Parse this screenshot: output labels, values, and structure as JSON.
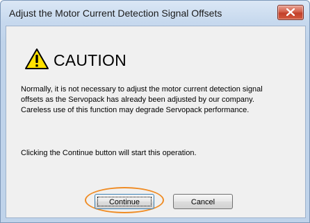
{
  "window": {
    "title": "Adjust the Motor Current Detection Signal Offsets"
  },
  "icons": {
    "close": "close-icon",
    "warning": "warning-triangle-icon"
  },
  "dialog": {
    "heading": "CAUTION",
    "message_lines": [
      "Normally, it is not necessary to adjust the motor current detection signal",
      "offsets as the Servopack has already been adjusted by our company.",
      "Careless use of this function may degrade Servopack performance."
    ],
    "instruction": "Clicking the Continue button will start this operation."
  },
  "buttons": {
    "continue_label": "Continue",
    "cancel_label": "Cancel"
  },
  "colors": {
    "highlight": "#ef8c25",
    "warning_fill": "#ffe100",
    "close_button": "#c2402a"
  }
}
